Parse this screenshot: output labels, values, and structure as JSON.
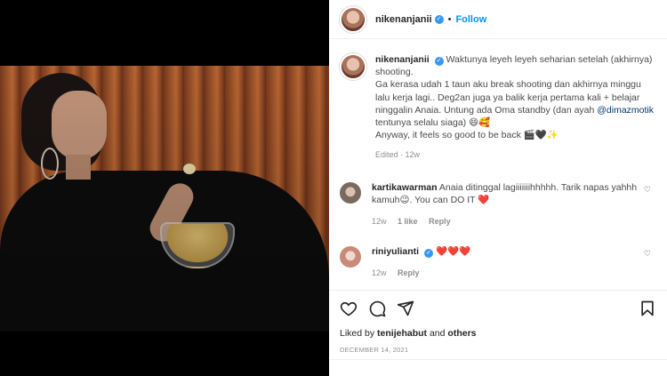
{
  "post": {
    "username": "nikenanjanii",
    "verified_icon": "verified-badge-icon",
    "follow_label": "Follow",
    "caption_lines": [
      "Waktunya leyeh leyeh seharian setelah (akhirnya) shooting.",
      "Ga kerasa udah 1 taun aku break shooting dan akhirnya minggu lalu kerja lagi.. Deg2an juga ya balik kerja pertama kali + belajar ninggalin Anaia. Untung ada Oma standby (dan ayah",
      "@dimazmotik",
      "tentunya selalu siaga) 😄🥰",
      "Anyway, it feels so good to be back 🎬🖤✨"
    ],
    "edited": "Edited · 12w"
  },
  "comments": [
    {
      "username": "kartikawarman",
      "text": "Anaia ditinggal lagiiiiiiihhhhh. Tarik napas yahhh kamuh😉. You can DO IT ❤️",
      "time": "12w",
      "likes": "1 like",
      "reply": "Reply"
    },
    {
      "username": "riniyulianti",
      "text": "❤️❤️❤️",
      "time": "12w",
      "reply": "Reply"
    }
  ],
  "footer": {
    "liked_prefix": "Liked by",
    "liked_user": "tenijehabut",
    "liked_suffix": "and",
    "liked_others": "others",
    "date": "DECEMBER 14, 2021"
  },
  "colors": {
    "link": "#0095f6",
    "mention": "#00376b",
    "muted": "#8e8e8e",
    "heart": "#ed4956"
  }
}
